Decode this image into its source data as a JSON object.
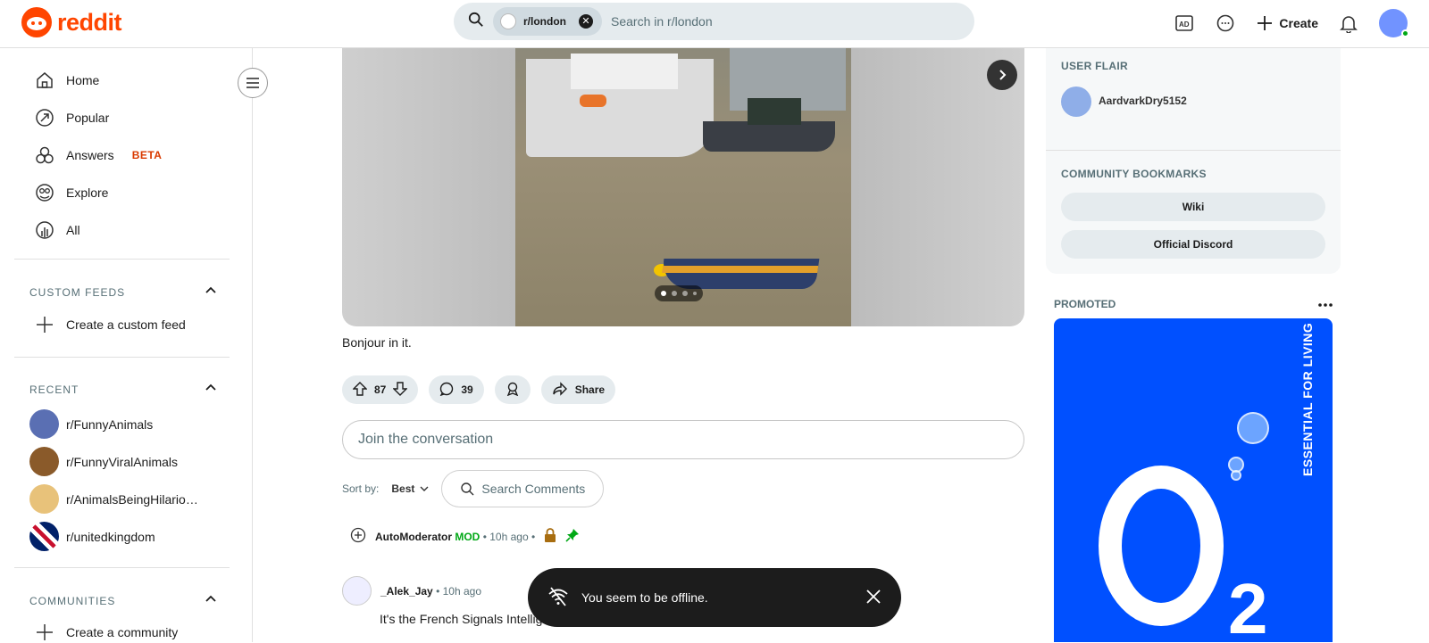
{
  "header": {
    "logo_text": "reddit",
    "search_chip": "r/london",
    "search_placeholder": "Search in r/london",
    "create_label": "Create"
  },
  "sidebar": {
    "nav": [
      {
        "label": "Home",
        "icon": "home-icon"
      },
      {
        "label": "Popular",
        "icon": "popular-icon"
      },
      {
        "label": "Answers",
        "icon": "answers-icon",
        "badge": "BETA"
      },
      {
        "label": "Explore",
        "icon": "explore-icon"
      },
      {
        "label": "All",
        "icon": "all-icon"
      }
    ],
    "custom_feeds_heading": "CUSTOM FEEDS",
    "create_custom_feed": "Create a custom feed",
    "recent_heading": "RECENT",
    "recent": [
      {
        "label": "r/FunnyAnimals",
        "color": "#5a6fb3"
      },
      {
        "label": "r/FunnyViralAnimals",
        "color": "#8a5a2a"
      },
      {
        "label": "r/AnimalsBeingHilario…",
        "color": "#e8c27a"
      },
      {
        "label": "r/unitedkingdom",
        "color": "#c8102e"
      }
    ],
    "communities_heading": "COMMUNITIES",
    "create_community": "Create a community"
  },
  "post": {
    "caption": "Bonjour in it.",
    "score": "87",
    "comments_count": "39",
    "share_label": "Share",
    "carousel_dots": 4,
    "carousel_active": 0
  },
  "comments": {
    "join_placeholder": "Join the conversation",
    "sort_label": "Sort by:",
    "sort_value": "Best",
    "search_comments": "Search Comments",
    "items": [
      {
        "author": "AutoModerator",
        "badge": "MOD",
        "sep": "•",
        "time": "10h ago"
      },
      {
        "author": "_Alek_Jay",
        "sep": "•",
        "time": "10h ago",
        "text": "It's the French Signals Intellig"
      }
    ]
  },
  "toast": {
    "message": "You seem to be offline."
  },
  "right": {
    "user_flair_heading": "USER FLAIR",
    "flair_user": "AardvarkDry5152",
    "bookmarks_heading": "COMMUNITY BOOKMARKS",
    "bookmarks": [
      "Wiki",
      "Official Discord"
    ],
    "promoted_label": "PROMOTED",
    "ad_tagline": "ESSENTIAL FOR LIVING",
    "ad_brand_sub": "2"
  },
  "colors": {
    "brand": "#ff4500",
    "mod_green": "#01a816",
    "ad_blue": "#0050ff"
  }
}
